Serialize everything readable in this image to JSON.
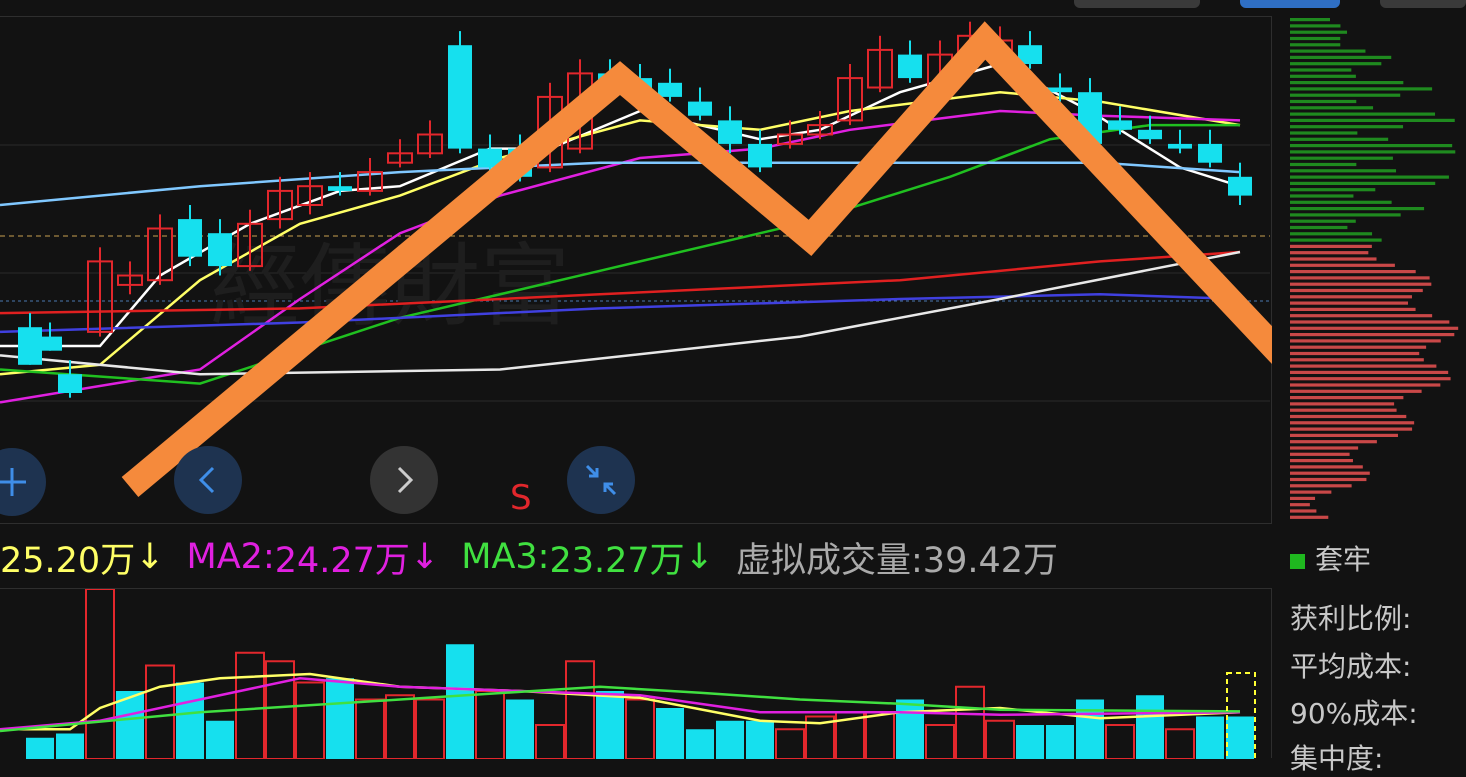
{
  "colors": {
    "background": "#121212",
    "up": "#e2272c",
    "down": "#16e0ee",
    "pattern_overlay": "#f58a3c",
    "ma5": "#ffffff",
    "ma10": "#ffff66",
    "ma20": "#e020e0",
    "ma30": "#20c020",
    "ma60": "#80c8ff",
    "ma120": "#e02020",
    "ma250": "#4040e0",
    "ma_long": "#e8e8e8",
    "chip_profit": "#1f8a1f",
    "chip_loss": "#c94848",
    "vol_ma1": "#ffff66",
    "vol_ma2": "#e020e0",
    "vol_ma3": "#40e040",
    "virtual_vol": "#aaaaaa"
  },
  "controls": {
    "zoom_in_icon": "plus-icon",
    "prev_icon": "chevron-left-icon",
    "next_icon": "chevron-right-icon",
    "fit_icon": "compress-icon"
  },
  "signal_label": "S",
  "watermark": "經傳財富",
  "volume_legend": {
    "ma1": "25.20万",
    "ma1_arrow": "↓",
    "ma2_label": "MA2:",
    "ma2": "24.27万",
    "ma2_arrow": "↓",
    "ma3_label": "MA3:",
    "ma3": "23.27万",
    "ma3_arrow": "↓",
    "virtual_label": "虚拟成交量:",
    "virtual_value": "39.42万"
  },
  "chip_panel": {
    "legend_label": "套牢",
    "rows": [
      "获利比例:",
      "平均成本:",
      "90%成本:",
      "集中度:"
    ]
  },
  "candles": [
    [
      30,
      26,
      34,
      26,
      "d"
    ],
    [
      50,
      29,
      32,
      29,
      "d"
    ],
    [
      70,
      20,
      24,
      19,
      "d"
    ],
    [
      100,
      33,
      48,
      32,
      "u"
    ],
    [
      130,
      43,
      45,
      41,
      "u"
    ],
    [
      160,
      44,
      55,
      43,
      "u"
    ],
    [
      190,
      49,
      57,
      47,
      "d"
    ],
    [
      220,
      47,
      54,
      45,
      "d"
    ],
    [
      250,
      47,
      56,
      46,
      "u"
    ],
    [
      280,
      57,
      63,
      55,
      "u"
    ],
    [
      310,
      60,
      64,
      58,
      "u"
    ],
    [
      340,
      64,
      63,
      62,
      "d"
    ],
    [
      370,
      63,
      67,
      62,
      "u"
    ],
    [
      400,
      69,
      71,
      68,
      "u"
    ],
    [
      430,
      71,
      75,
      70,
      "u"
    ],
    [
      460,
      72,
      94,
      71,
      "d"
    ],
    [
      490,
      72,
      68,
      67,
      "d"
    ],
    [
      520,
      72,
      66,
      65,
      "d"
    ],
    [
      550,
      68,
      83,
      67,
      "u"
    ],
    [
      580,
      72,
      88,
      71,
      "u"
    ],
    [
      610,
      85,
      88,
      83,
      "d"
    ],
    [
      640,
      87,
      83,
      82,
      "d"
    ],
    [
      670,
      86,
      83,
      82,
      "d"
    ],
    [
      700,
      82,
      79,
      78,
      "d"
    ],
    [
      730,
      78,
      73,
      71,
      "d"
    ],
    [
      760,
      73,
      68,
      67,
      "d"
    ],
    [
      790,
      73,
      75,
      72,
      "u"
    ],
    [
      820,
      75,
      77,
      74,
      "u"
    ],
    [
      850,
      78,
      87,
      77,
      "u"
    ],
    [
      880,
      85,
      93,
      84,
      "u"
    ],
    [
      910,
      92,
      87,
      86,
      "d"
    ],
    [
      940,
      84,
      92,
      83,
      "u"
    ],
    [
      970,
      91,
      96,
      90,
      "u"
    ],
    [
      1000,
      93,
      95,
      92,
      "u"
    ],
    [
      1030,
      94,
      90,
      89,
      "d"
    ],
    [
      1060,
      85,
      84,
      82,
      "d"
    ],
    [
      1090,
      84,
      73,
      70,
      "d"
    ],
    [
      1120,
      78,
      76,
      75,
      "d"
    ],
    [
      1150,
      76,
      74,
      73,
      "d"
    ],
    [
      1180,
      73,
      72,
      71,
      "d"
    ],
    [
      1210,
      73,
      69,
      68,
      "d"
    ],
    [
      1240,
      66,
      62,
      60,
      "d"
    ]
  ],
  "volumes": [
    [
      40,
      25,
      "d"
    ],
    [
      70,
      30,
      "d"
    ],
    [
      100,
      200,
      "u"
    ],
    [
      130,
      80,
      "d"
    ],
    [
      160,
      110,
      "u"
    ],
    [
      190,
      90,
      "d"
    ],
    [
      220,
      45,
      "d"
    ],
    [
      250,
      125,
      "u"
    ],
    [
      280,
      115,
      "u"
    ],
    [
      310,
      90,
      "u"
    ],
    [
      340,
      95,
      "d"
    ],
    [
      370,
      70,
      "u"
    ],
    [
      400,
      75,
      "u"
    ],
    [
      430,
      70,
      "u"
    ],
    [
      460,
      135,
      "d"
    ],
    [
      490,
      80,
      "u"
    ],
    [
      520,
      70,
      "d"
    ],
    [
      550,
      40,
      "u"
    ],
    [
      580,
      115,
      "u"
    ],
    [
      610,
      80,
      "d"
    ],
    [
      640,
      70,
      "u"
    ],
    [
      670,
      60,
      "d"
    ],
    [
      700,
      35,
      "d"
    ],
    [
      730,
      45,
      "d"
    ],
    [
      760,
      45,
      "d"
    ],
    [
      790,
      35,
      "u"
    ],
    [
      820,
      50,
      "u"
    ],
    [
      850,
      55,
      "u"
    ],
    [
      880,
      55,
      "u"
    ],
    [
      910,
      70,
      "d"
    ],
    [
      940,
      40,
      "u"
    ],
    [
      970,
      85,
      "u"
    ],
    [
      1000,
      45,
      "u"
    ],
    [
      1030,
      40,
      "d"
    ],
    [
      1060,
      40,
      "d"
    ],
    [
      1090,
      70,
      "d"
    ],
    [
      1120,
      40,
      "u"
    ],
    [
      1150,
      75,
      "d"
    ],
    [
      1180,
      35,
      "u"
    ],
    [
      1210,
      50,
      "d"
    ],
    [
      1240,
      50,
      "d"
    ]
  ]
}
